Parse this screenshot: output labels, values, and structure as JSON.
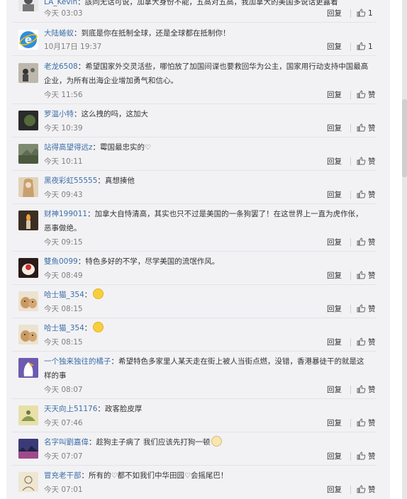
{
  "actions": {
    "reply": "回复"
  },
  "comments": [
    {
      "user": "LA_Kevin",
      "sep": "：",
      "text": "該同无话可说，加拿大身份不能，五高对五高，我加拿大的美国多说话更露着",
      "time": "今天 03:03",
      "like": "1",
      "avatar": "avatar-person",
      "mention": ""
    },
    {
      "user": "大陆蜷蚁",
      "sep": "：",
      "text": "到底是你在抵制全球，还是全球都在抵制你！",
      "time": "10月17日 19:37",
      "like": "1",
      "avatar": "avatar-ie-logo",
      "mention": ""
    },
    {
      "user": "老龙6508",
      "sep": "：",
      "text": "希望国家外交灵活些，哪怕放了加国间谍也要救回华为公主，国家用行动支持中国最高企业，为所有出海企业增加勇气和信心。",
      "time": "今天 11:56",
      "like": "赞",
      "avatar": "avatar-photo"
    },
    {
      "user": "罗温小特",
      "sep": "：",
      "text": "这么拽的吗，这加大",
      "time": "今天 10:39",
      "like": "赞",
      "avatar": "avatar-dark"
    },
    {
      "user": "站得高望得远z",
      "sep": "：",
      "text": "霉国最忠实的",
      "time": "今天 10:11",
      "like": "赞",
      "avatar": "avatar-landscape"
    },
    {
      "user": "黑夜彩虹55555",
      "sep": "：",
      "text": "真想揍他",
      "time": "今天 09:43",
      "like": "赞",
      "avatar": "avatar-girl"
    },
    {
      "user": "财神199011",
      "sep": "：",
      "text": "加拿大自恃清高，其实也只不过是美国的一条狗罢了！在这世界上一直为虎作伥，恶事做绝。",
      "time": "今天 09:15",
      "like": "赞",
      "avatar": "avatar-candle"
    },
    {
      "user": "雙魚0099",
      "sep": "：",
      "text": "特色多好的不学，尽学美国的流氓作风。",
      "time": "今天 08:49",
      "like": "赞",
      "avatar": "avatar-cake"
    },
    {
      "user": "哈士猫_354",
      "sep": "：",
      "text": "",
      "time": "今天 08:15",
      "like": "赞",
      "avatar": "avatar-dog"
    },
    {
      "user": "哈士猫_354",
      "sep": "：",
      "text": "",
      "time": "今天 08:15",
      "like": "赞",
      "avatar": "avatar-dog"
    },
    {
      "user": "一个独来独往的橘子",
      "sep": "：",
      "text": "希望特色多家里人某天走在街上被人当街点燃，没错，香港暴徒干的就是这样的事",
      "time": "今天 08:07",
      "like": "赞",
      "avatar": "avatar-penguin"
    },
    {
      "user": "天天向上51176",
      "sep": "：",
      "text": "政客脸皮厚",
      "time": "今天 07:46",
      "like": "赞",
      "avatar": "avatar-yellow"
    },
    {
      "user": "名字叫劉嘉偉",
      "sep": "：",
      "text": "趁狗主子病了 我们应该先打狗一顿",
      "time": "今天 07:07",
      "like": "赞",
      "avatar": "avatar-sky"
    },
    {
      "user": "冒充老干部",
      "sep": "：",
      "text": "所有的",
      "text2": "都不如我们中华田园",
      "text3": "会摇尾巴！",
      "time": "今天 07:01",
      "like": "赞",
      "avatar": "avatar-sketch"
    }
  ]
}
